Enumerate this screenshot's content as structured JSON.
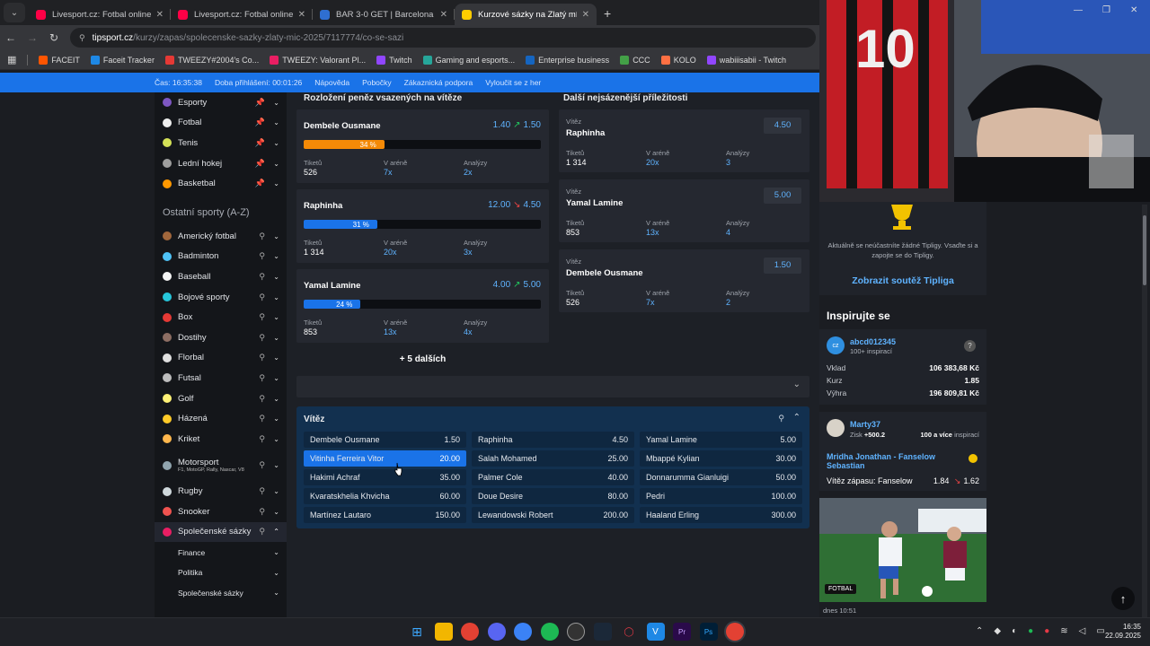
{
  "browser": {
    "tabs": [
      {
        "title": "Livesport.cz: Fotbal online, fotb",
        "color": "#ff0046"
      },
      {
        "title": "Livesport.cz: Fotbal online, fotb",
        "color": "#ff0046"
      },
      {
        "title": "BAR 3-0 GET | Barcelona - Getaf",
        "color": "#2f6fd1"
      },
      {
        "title": "Kurzové sázky na Zlatý míč 2025",
        "color": "#ffcc00"
      }
    ],
    "url_host": "tipsport.cz",
    "url_path": "/kurzy/zapas/spolecenske-sazky-zlaty-mic-2025/7117774/co-se-sazi",
    "bookmarks": [
      {
        "label": "FACEIT",
        "color": "#ff5500"
      },
      {
        "label": "Faceit Tracker",
        "color": "#1e88e5"
      },
      {
        "label": "TWEEZY#2004's Co...",
        "color": "#e53935"
      },
      {
        "label": "TWEEZY: Valorant Pl...",
        "color": "#e91e63"
      },
      {
        "label": "Twitch",
        "color": "#9146ff"
      },
      {
        "label": "Gaming and esports...",
        "color": "#26a69a"
      },
      {
        "label": "Enterprise business",
        "color": "#1565c0"
      },
      {
        "label": "CCC",
        "color": "#43a047"
      },
      {
        "label": "KOLO",
        "color": "#ff7043"
      },
      {
        "label": "wabiiisabii - Twitch",
        "color": "#9146ff"
      }
    ]
  },
  "sitebar": {
    "time": "Čas: 16:35:38",
    "session": "Doba přihlášení: 00:01:26",
    "help": "Nápověda",
    "branches": "Pobočky",
    "support": "Zákaznická podpora",
    "exclude": "Vyloučit se z her"
  },
  "leftnav": {
    "top_items": [
      {
        "label": "Esporty",
        "color": "#7e57c2"
      },
      {
        "label": "Fotbal",
        "color": "#eeeeee"
      },
      {
        "label": "Tenis",
        "color": "#d4e157"
      },
      {
        "label": "Lední hokej",
        "color": "#9e9e9e"
      },
      {
        "label": "Basketbal",
        "color": "#ff9800"
      }
    ],
    "other_heading": "Ostatní sporty (A-Z)",
    "other_items": [
      {
        "label": "Americký fotbal",
        "color": "#a1673c"
      },
      {
        "label": "Badminton",
        "color": "#4fc3f7"
      },
      {
        "label": "Baseball",
        "color": "#f5f5f5"
      },
      {
        "label": "Bojové sporty",
        "color": "#26c6da"
      },
      {
        "label": "Box",
        "color": "#e53935"
      },
      {
        "label": "Dostihy",
        "color": "#8d6e63"
      },
      {
        "label": "Florbal",
        "color": "#e0e0e0"
      },
      {
        "label": "Futsal",
        "color": "#bdbdbd"
      },
      {
        "label": "Golf",
        "color": "#fff176"
      },
      {
        "label": "Házená",
        "color": "#ffca28"
      },
      {
        "label": "Kriket",
        "color": "#ffb74d"
      }
    ],
    "motorsport": {
      "label": "Motorsport",
      "sub": "F1, MotoGP, Rally, Nascar, V8",
      "color": "#90a4ae"
    },
    "more_items": [
      {
        "label": "Rugby",
        "color": "#cfd8dc"
      },
      {
        "label": "Snooker",
        "color": "#ef5350"
      }
    ],
    "active_item": {
      "label": "Společenské sázky",
      "color": "#e91e63"
    },
    "sub_items": [
      "Finance",
      "Politika",
      "Společenské sázky"
    ]
  },
  "distribution": {
    "title": "Rozložení peněz vsazených na vítěze",
    "label_tickets": "Tiketů",
    "label_arena": "V aréně",
    "label_analyses": "Analýzy",
    "players": [
      {
        "name": "Dembele Ousmane",
        "odds_from": "1.40",
        "arrow": "↗",
        "arrow_color": "#22c55e",
        "odds_to": "1.50",
        "percent": "34 %",
        "share": 0.34,
        "bar_color": "#f58a07",
        "tickets": "526",
        "arena": "7x",
        "analyses": "2x"
      },
      {
        "name": "Raphinha",
        "odds_from": "12.00",
        "arrow": "↘",
        "arrow_color": "#ef4444",
        "odds_to": "4.50",
        "percent": "31 %",
        "share": 0.31,
        "bar_color": "#1a73e8",
        "tickets": "1 314",
        "arena": "20x",
        "analyses": "3x"
      },
      {
        "name": "Yamal Lamine",
        "odds_from": "4.00",
        "arrow": "↗",
        "arrow_color": "#22c55e",
        "odds_to": "5.00",
        "percent": "24 %",
        "share": 0.24,
        "bar_color": "#1a73e8",
        "tickets": "853",
        "arena": "13x",
        "analyses": "4x"
      }
    ],
    "more": "+ 5 dalších"
  },
  "opportunities": {
    "title": "Další nejsázenější příležitosti",
    "items": [
      {
        "label": "Vítěz",
        "name": "Raphinha",
        "odds": "4.50",
        "tickets": "1 314",
        "arena": "20x",
        "analyses": "3"
      },
      {
        "label": "Vítěz",
        "name": "Yamal Lamine",
        "odds": "5.00",
        "tickets": "853",
        "arena": "13x",
        "analyses": "4"
      },
      {
        "label": "Vítěz",
        "name": "Dembele Ousmane",
        "odds": "1.50",
        "tickets": "526",
        "arena": "7x",
        "analyses": "2"
      }
    ]
  },
  "winner": {
    "title": "Vítěz",
    "selections": [
      {
        "name": "Dembele Ousmane",
        "odds": "1.50"
      },
      {
        "name": "Raphinha",
        "odds": "4.50"
      },
      {
        "name": "Yamal Lamine",
        "odds": "5.00"
      },
      {
        "name": "Vitinha Ferreira Vitor",
        "odds": "20.00",
        "selected": true
      },
      {
        "name": "Salah Mohamed",
        "odds": "25.00"
      },
      {
        "name": "Mbappé Kylian",
        "odds": "30.00"
      },
      {
        "name": "Hakimi Achraf",
        "odds": "35.00"
      },
      {
        "name": "Palmer Cole",
        "odds": "40.00"
      },
      {
        "name": "Donnarumma Gianluigi",
        "odds": "50.00"
      },
      {
        "name": "Kvaratskhelia Khvicha",
        "odds": "60.00"
      },
      {
        "name": "Doue Desire",
        "odds": "80.00"
      },
      {
        "name": "Pedri",
        "odds": "100.00"
      },
      {
        "name": "Martínez Lautaro",
        "odds": "150.00"
      },
      {
        "name": "Lewandowski Robert",
        "odds": "200.00"
      },
      {
        "name": "Haaland Erling",
        "odds": "300.00"
      }
    ]
  },
  "right": {
    "tipliga_text": "Aktuálně se neúčastníte žádné Tipligy. Vsaďte si a zapojte se do Tipligy.",
    "tipliga_link": "Zobrazit soutěž Tipliga",
    "inspire_title": "Inspirujte se",
    "user1": {
      "name": "abcd012345",
      "sub": "100+ inspirací",
      "avatar": "cz",
      "help": "?"
    },
    "bet": [
      {
        "k": "Vklad",
        "v": "106 383,68 Kč"
      },
      {
        "k": "Kurz",
        "v": "1.85"
      },
      {
        "k": "Výhra",
        "v": "196 809,81 Kč"
      }
    ],
    "user2": {
      "name": "Marty37",
      "gain_label": "Zisk",
      "gain": "+500.2",
      "insp": "100 a více",
      "insp_label": "inspirací"
    },
    "match": "Mridha Jonathan - Fanselow Sebastian",
    "market": "Vítěz zápasu: Fanselow",
    "odds_from": "1.84",
    "odds_to": "1.62",
    "tag": "FOTBAL",
    "date": "dnes 10:51"
  },
  "taskbar": {
    "time": "16:35",
    "date": "22.09.2025"
  }
}
